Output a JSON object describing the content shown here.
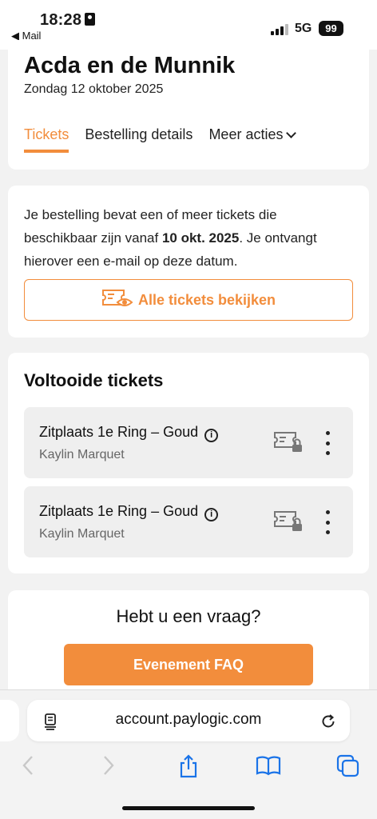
{
  "status": {
    "time": "18:28",
    "back_label": "◀ Mail",
    "network": "5G",
    "battery": "99"
  },
  "event": {
    "title": "Acda en de Munnik",
    "date": "Zondag 12 oktober 2025"
  },
  "tabs": [
    {
      "label": "Tickets",
      "active": true
    },
    {
      "label": "Bestelling details",
      "active": false
    },
    {
      "label": "Meer acties",
      "active": false
    }
  ],
  "notice": {
    "text_before": "Je bestelling bevat een of meer tickets die beschikbaar zijn vanaf ",
    "date_bold": "10 okt. 2025",
    "text_after": ". Je ontvangt hierover een e-mail op deze datum.",
    "button_label": "Alle tickets bekijken"
  },
  "completed": {
    "title": "Voltooide tickets",
    "tickets": [
      {
        "name": "Zitplaats 1e Ring – Goud",
        "holder": "Kaylin Marquet"
      },
      {
        "name": "Zitplaats 1e Ring – Goud",
        "holder": "Kaylin Marquet"
      }
    ]
  },
  "faq": {
    "question": "Hebt u een vraag?",
    "button_label": "Evenement FAQ"
  },
  "browser": {
    "url": "account.paylogic.com"
  },
  "colors": {
    "accent": "#f28d3c",
    "icon_blue": "#1a73e8"
  },
  "icons": [
    "person-icon",
    "signal-icon",
    "ticket-eye-icon",
    "info-icon",
    "ticket-lock-icon",
    "kebab-icon",
    "page-icon",
    "reload-icon",
    "back-icon",
    "forward-icon",
    "share-icon",
    "bookmarks-icon",
    "tabs-icon"
  ]
}
